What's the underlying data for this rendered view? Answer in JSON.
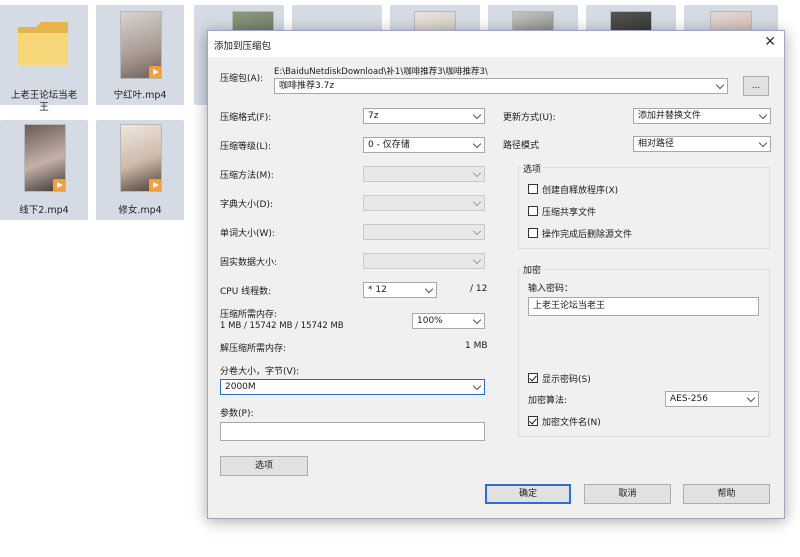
{
  "explorer": {
    "tiles": [
      {
        "label": "上老王论坛当老\n王",
        "kind": "folder"
      },
      {
        "label": "宁红叶.mp4",
        "kind": "video"
      },
      {
        "label": "线下2.mp4",
        "kind": "video"
      },
      {
        "label": "修女.mp4",
        "kind": "video"
      }
    ]
  },
  "dialog": {
    "title": "添加到压缩包",
    "close_glyph": "✕",
    "archive": {
      "label": "压缩包(A):",
      "path": "E:\\BaiduNetdiskDownload\\补1\\咖啡推荐3\\咖啡推荐3\\",
      "name": "咖啡推荐3.7z",
      "browse_label": "..."
    },
    "format": {
      "label": "压缩格式(F):",
      "value": "7z"
    },
    "level": {
      "label": "压缩等级(L):",
      "value": "0 - 仅存储"
    },
    "method": {
      "label": "压缩方法(M):",
      "value": ""
    },
    "dict": {
      "label": "字典大小(D):",
      "value": ""
    },
    "word": {
      "label": "单词大小(W):",
      "value": ""
    },
    "solid": {
      "label": "固实数据大小:",
      "value": ""
    },
    "threads": {
      "label": "CPU 线程数:",
      "value": "* 12",
      "max": "/ 12"
    },
    "mem": {
      "label": "压缩所需内存:",
      "detail": "1 MB / 15742 MB / 15742 MB",
      "value": "100%"
    },
    "decomp": {
      "label": "解压缩所需内存:",
      "value": "1 MB"
    },
    "volume": {
      "label": "分卷大小，字节(V):",
      "value": "2000M"
    },
    "params": {
      "label": "参数(P):",
      "value": ""
    },
    "options_button": "选项",
    "update": {
      "label": "更新方式(U):",
      "value": "添加并替换文件"
    },
    "pathmode": {
      "label": "路径模式",
      "value": "相对路径"
    },
    "options_group": {
      "title": "选项",
      "items": [
        {
          "label": "创建自释放程序(X)",
          "checked": false
        },
        {
          "label": "压缩共享文件",
          "checked": false
        },
        {
          "label": "操作完成后删除源文件",
          "checked": false
        }
      ]
    },
    "encrypt": {
      "title": "加密",
      "password_label": "输入密码：",
      "password": "上老王论坛当老王",
      "show_password": {
        "label": "显示密码(S)",
        "checked": true
      },
      "method_label": "加密算法:",
      "method_value": "AES-256",
      "encrypt_names": {
        "label": "加密文件名(N)",
        "checked": true
      }
    },
    "buttons": {
      "ok": "确定",
      "cancel": "取消",
      "help": "帮助"
    }
  }
}
